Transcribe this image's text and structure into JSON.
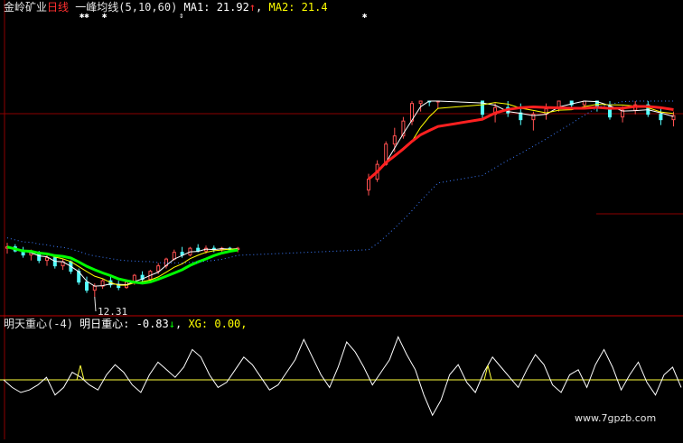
{
  "header": {
    "stock_name": "金岭矿业",
    "period": "日线",
    "indicator": "一峰均线",
    "params": "(5,10,60)",
    "ma1_label": "MA1:",
    "ma1_value": "21.92",
    "ma1_arrow": "↑",
    "sep": ",",
    "ma2_label": "MA2:",
    "ma2_value": "21.4"
  },
  "markers": [
    "✱✱",
    "✱",
    "⇕",
    "✱"
  ],
  "low_label": "12.31",
  "sub_header": {
    "name": "明天重心",
    "param": "(-4)",
    "line_label": "明日重心:",
    "line_value": "-0.83",
    "line_arrow": "↓",
    "sep1": ",",
    "xg_label": "XG:",
    "xg_value": "0.00",
    "sep2": ","
  },
  "watermark": "www.7gpzb.com",
  "colors": {
    "up": "#ff5050",
    "down": "#54ffff",
    "ma_white": "#ffffff",
    "ma_yellow": "#ffff00",
    "ma_green": "#00ff00",
    "ma_red": "#ff2020",
    "ma_dots": "#3b7bff",
    "grid": "#8b0000",
    "sub_yellow": "#ffff3c"
  },
  "chart_data": {
    "type": "candlestick",
    "price_low_marked": 12.31,
    "gap_note": "price jump after bar 46",
    "candles": [
      [
        15.9,
        16.3,
        15.5,
        16.0
      ],
      [
        16.0,
        16.2,
        15.6,
        15.7
      ],
      [
        15.7,
        16.0,
        15.2,
        15.4
      ],
      [
        15.4,
        15.8,
        15.0,
        15.6
      ],
      [
        15.6,
        15.7,
        14.8,
        15.0
      ],
      [
        15.0,
        15.4,
        14.6,
        15.2
      ],
      [
        15.2,
        15.3,
        14.4,
        14.6
      ],
      [
        14.6,
        15.1,
        14.3,
        14.9
      ],
      [
        14.9,
        15.0,
        14.0,
        14.2
      ],
      [
        14.2,
        14.4,
        13.2,
        13.4
      ],
      [
        13.4,
        13.8,
        12.6,
        12.8
      ],
      [
        12.8,
        13.3,
        12.31,
        13.1
      ],
      [
        13.1,
        13.6,
        12.9,
        13.5
      ],
      [
        13.5,
        13.8,
        13.0,
        13.2
      ],
      [
        13.2,
        13.5,
        12.8,
        13.0
      ],
      [
        13.0,
        13.6,
        12.9,
        13.4
      ],
      [
        13.4,
        14.0,
        13.2,
        13.9
      ],
      [
        13.9,
        14.2,
        13.4,
        13.6
      ],
      [
        13.6,
        14.3,
        13.5,
        14.2
      ],
      [
        14.2,
        14.8,
        14.0,
        14.6
      ],
      [
        14.6,
        15.2,
        14.4,
        15.1
      ],
      [
        15.1,
        15.8,
        15.0,
        15.6
      ],
      [
        15.6,
        16.0,
        15.2,
        15.4
      ],
      [
        15.4,
        16.0,
        15.3,
        15.9
      ],
      [
        15.9,
        16.2,
        15.6,
        15.7
      ],
      [
        15.7,
        16.1,
        15.5,
        15.9
      ],
      [
        15.9,
        16.1,
        15.6,
        15.8
      ],
      [
        15.8,
        16.0,
        15.6,
        15.9
      ],
      [
        15.9,
        16.0,
        15.7,
        15.8
      ],
      [
        15.8,
        16.0,
        15.6,
        15.9
      ],
      [
        20.2,
        21.4,
        19.8,
        21.0
      ],
      [
        21.0,
        22.4,
        20.8,
        22.1
      ],
      [
        22.1,
        23.8,
        22.0,
        23.6
      ],
      [
        23.6,
        24.8,
        23.0,
        24.2
      ],
      [
        24.2,
        25.6,
        24.0,
        25.3
      ],
      [
        25.3,
        26.9,
        25.0,
        26.6
      ],
      [
        26.6,
        27.6,
        26.0,
        27.2
      ],
      [
        27.2,
        27.9,
        26.4,
        26.8
      ],
      [
        26.8,
        27.5,
        26.2,
        27.3
      ],
      [
        27.3,
        27.6,
        25.4,
        25.8
      ],
      [
        25.8,
        26.6,
        25.2,
        26.3
      ],
      [
        26.3,
        26.9,
        25.6,
        25.9
      ],
      [
        25.9,
        26.6,
        25.0,
        25.4
      ],
      [
        25.4,
        26.0,
        24.6,
        25.8
      ],
      [
        25.8,
        26.6,
        25.4,
        26.2
      ],
      [
        26.2,
        27.2,
        26.0,
        27.0
      ],
      [
        27.0,
        27.6,
        26.3,
        26.5
      ],
      [
        26.5,
        27.5,
        26.2,
        27.3
      ],
      [
        27.3,
        27.6,
        26.0,
        26.4
      ],
      [
        26.4,
        26.8,
        25.4,
        25.6
      ],
      [
        25.6,
        26.4,
        25.2,
        26.1
      ],
      [
        26.1,
        26.8,
        25.8,
        26.5
      ],
      [
        26.5,
        27.0,
        25.6,
        25.8
      ],
      [
        25.8,
        26.3,
        25.0,
        25.4
      ],
      [
        25.4,
        26.0,
        24.9,
        25.7
      ]
    ],
    "sub_series": [
      0,
      -0.3,
      -0.5,
      -0.4,
      -0.2,
      0.1,
      -0.6,
      -0.3,
      0.3,
      0.1,
      -0.2,
      -0.4,
      0.2,
      0.6,
      0.3,
      -0.2,
      -0.5,
      0.2,
      0.7,
      0.4,
      0.1,
      0.5,
      1.2,
      0.9,
      0.2,
      -0.3,
      -0.1,
      0.4,
      0.9,
      0.6,
      0.1,
      -0.4,
      -0.2,
      0.3,
      0.8,
      1.6,
      0.9,
      0.2,
      -0.3,
      0.5,
      1.5,
      1.1,
      0.5,
      -0.2,
      0.3,
      0.8,
      1.7,
      1.0,
      0.4,
      -0.6,
      -1.4,
      -0.8,
      0.2,
      0.6,
      -0.1,
      -0.5,
      0.3,
      0.9,
      0.5,
      0.1,
      -0.3,
      0.4,
      1.0,
      0.6,
      -0.2,
      -0.5,
      0.2,
      0.4,
      -0.3,
      0.6,
      1.2,
      0.5,
      -0.4,
      0.2,
      0.7,
      -0.1,
      -0.6,
      0.2,
      0.5,
      -0.3
    ]
  }
}
